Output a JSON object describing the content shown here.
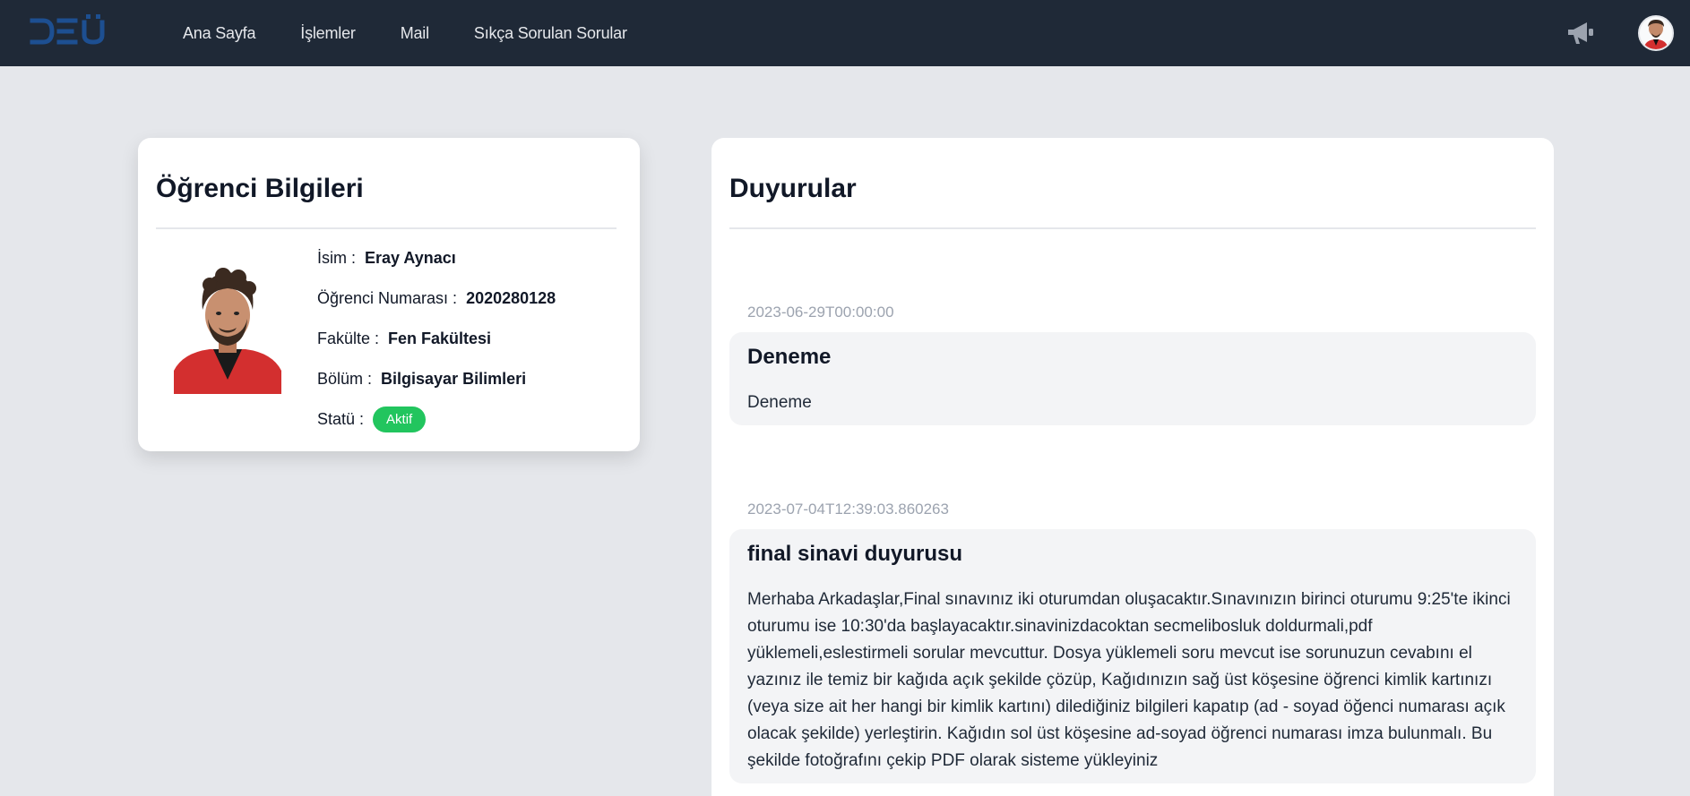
{
  "brand": {
    "logo_text": "DEÜ"
  },
  "nav": {
    "links": [
      "Ana Sayfa",
      "İşlemler",
      "Mail",
      "Sıkça Sorulan Sorular"
    ],
    "icons": [
      "megaphone-icon",
      "user-avatar"
    ]
  },
  "student": {
    "title": "Öğrenci Bilgileri",
    "fields": [
      {
        "label": "İsim :",
        "value": "Eray Aynacı"
      },
      {
        "label": "Öğrenci Numarası :",
        "value": "2020280128"
      },
      {
        "label": "Fakülte :",
        "value": "Fen Fakültesi"
      },
      {
        "label": "Bölüm :",
        "value": "Bilgisayar Bilimleri"
      }
    ],
    "status_label": "Statü :",
    "status_value": "Aktif",
    "status_color": "#22c55e"
  },
  "announcements": {
    "title": "Duyurular",
    "items": [
      {
        "date": "2023-06-29T00:00:00",
        "title": "Deneme",
        "body": "Deneme"
      },
      {
        "date": "2023-07-04T12:39:03.860263",
        "title": "final sinavi duyurusu",
        "body": "Merhaba Arkadaşlar,Final sınavınız iki oturumdan oluşacaktır.Sınavınızın birinci oturumu 9:25'te ikinci oturumu ise 10:30'da başlayacaktır.sinavinizdacoktan secmelibosluk doldurmali,pdf yüklemeli,eslestirmeli sorular mevcuttur. Dosya yüklemeli soru mevcut ise sorunuzun cevabını el yazınız ile temiz bir kağıda açık şekilde çözüp, Kağıdınızın sağ üst köşesine öğrenci kimlik kartınızı (veya size ait her hangi bir kimlik kartını) dilediğiniz bilgileri kapatıp (ad - soyad öğenci numarası açık olacak şekilde) yerleştirin. Kağıdın sol üst köşesine ad-soyad öğrenci numarası imza bulunmalı. Bu şekilde fotoğrafını çekip PDF olarak sisteme yükleyiniz"
      }
    ]
  },
  "colors": {
    "navbar_bg": "#1f2937",
    "page_bg": "#e5e7eb",
    "logo": "#1d4f91",
    "badge": "#22c55e"
  }
}
